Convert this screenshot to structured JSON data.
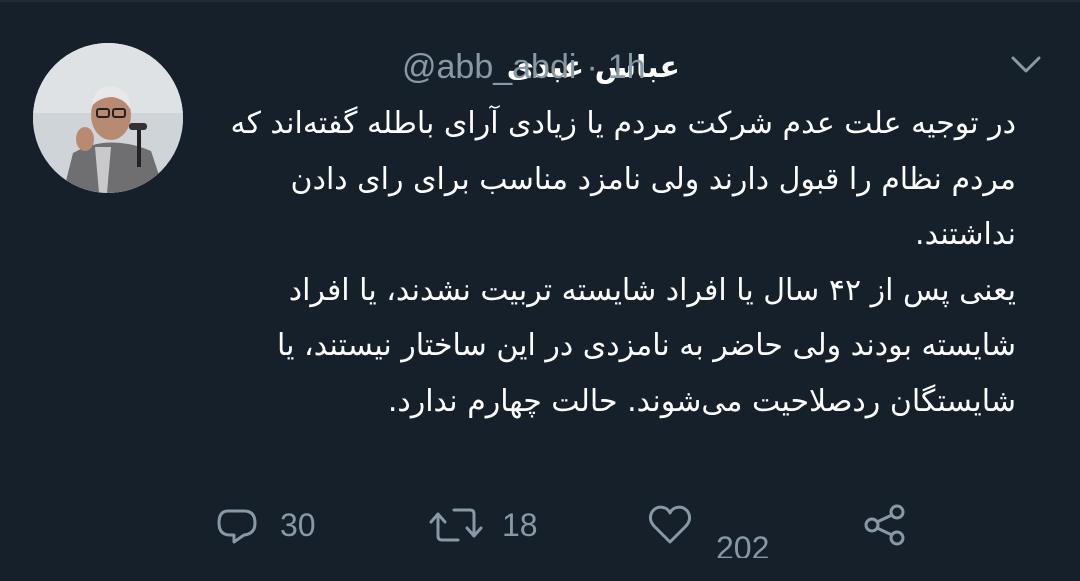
{
  "tweet": {
    "display_name": "عباس عبدی",
    "handle": "@abb_abdi",
    "separator": "·",
    "time": "1h",
    "text_paragraphs": [
      "در توجیه علت عدم شرکت مردم یا زیادی آرای باطله گفته‌اند که مردم نظام را قبول دارند ولی نامزد مناسب برای رای دادن نداشتند.",
      "یعنی پس از ۴۲ سال یا افراد شایسته تربیت نشدند، یا افراد شایسته بودند ولی حاضر به نامزدی در این ساختار نیستند، یا شایستگان ردصلاحیت می‌شوند. حالت چهارم ندارد."
    ]
  },
  "actions": {
    "reply_count": "30",
    "retweet_count": "18",
    "like_count": "202"
  },
  "icons": {
    "menu": "chevron-down-icon",
    "reply": "reply-icon",
    "retweet": "retweet-icon",
    "like": "heart-icon",
    "share": "share-icon"
  },
  "colors": {
    "background": "#15202b",
    "text": "#ffffff",
    "secondary": "#8899a6"
  }
}
